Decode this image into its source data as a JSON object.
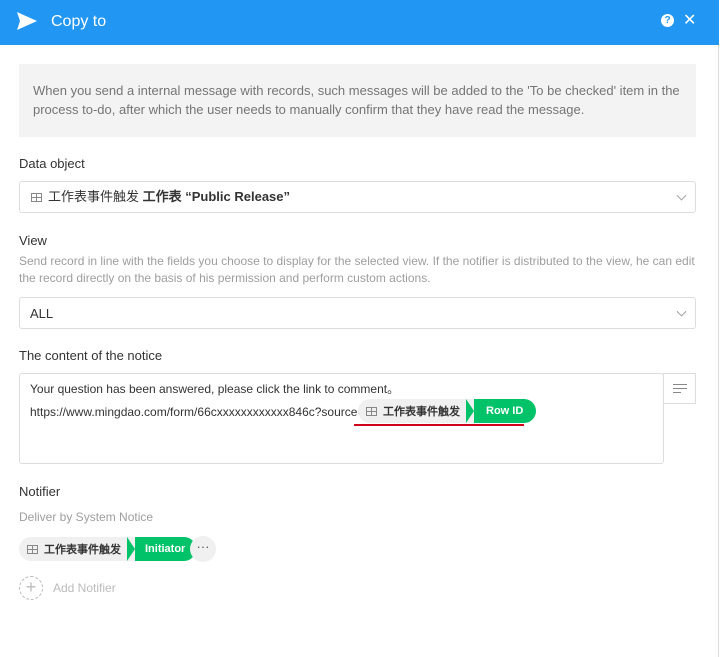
{
  "header": {
    "title": "Copy to",
    "help_label": "?",
    "close_label": "✕",
    "bg_color": "#2196f3"
  },
  "info": {
    "text": "When you send a internal message with records, such messages will be added to the 'To be checked' item in the process to-do, after which the user needs to manually confirm that they have read the message."
  },
  "data_object": {
    "label": "Data object",
    "source_name": "工作表事件触发",
    "value": "工作表 “Public Release”"
  },
  "view": {
    "label": "View",
    "description": "Send record in line with the fields you choose to display for the selected view. If the notifier is distributed to the view, he can edit the record directly on the basis of his permission and perform custom actions.",
    "value": "ALL"
  },
  "notice": {
    "label": "The content of the notice",
    "line1": "Your question has been answered, please click the link to comment。",
    "line2": "https://www.mingdao.com/form/66cxxxxxxxxxxxx846c?source=",
    "tag": {
      "source": "工作表事件触发",
      "field": "Row ID"
    }
  },
  "notifier": {
    "label": "Notifier",
    "description": "Deliver by System Notice",
    "tag": {
      "source": "工作表事件触发",
      "field": "Initiator"
    },
    "more_label": "···",
    "add_label": "Add Notifier",
    "add_symbol": "+"
  },
  "colors": {
    "accent": "#2196f3",
    "tag_green": "#00c268",
    "underline_red": "#d0021b"
  }
}
